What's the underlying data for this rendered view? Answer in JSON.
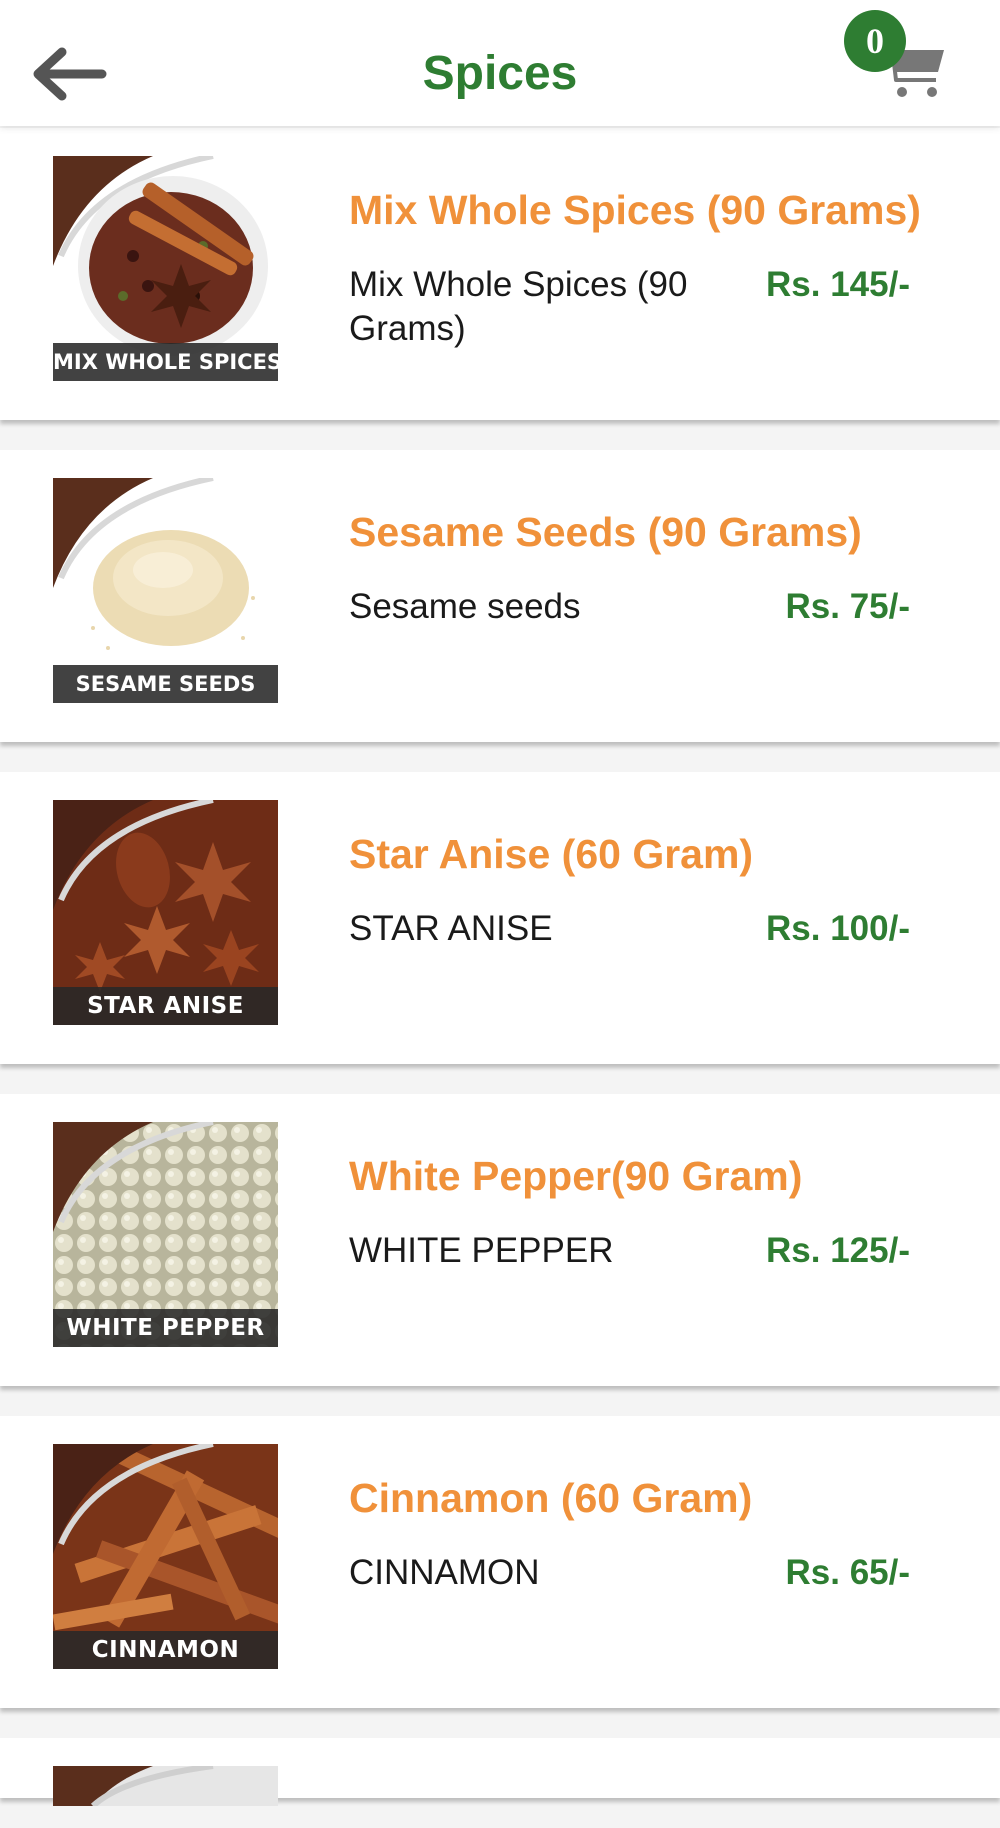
{
  "header": {
    "title": "Spices",
    "cart_count": "0"
  },
  "products": [
    {
      "name": "Mix Whole Spices (90 Grams)",
      "description": "Mix Whole Spices (90 Grams)",
      "price": "Rs. 145/-",
      "image_label": "MIX WHOLE SPICES"
    },
    {
      "name": "Sesame Seeds (90 Grams)",
      "description": "Sesame seeds",
      "price": "Rs. 75/-",
      "image_label": "SESAME SEEDS"
    },
    {
      "name": "Star Anise (60 Gram)",
      "description": "STAR ANISE",
      "price": "Rs. 100/-",
      "image_label": "STAR ANISE"
    },
    {
      "name": "White Pepper(90 Gram)",
      "description": "WHITE PEPPER",
      "price": "Rs. 125/-",
      "image_label": "WHITE PEPPER"
    },
    {
      "name": "Cinnamon (60 Gram)",
      "description": "CINNAMON",
      "price": "Rs. 65/-",
      "image_label": "CINNAMON"
    }
  ],
  "icons": {
    "back": "back-arrow-icon",
    "cart": "shopping-cart-icon"
  },
  "colors": {
    "brand_green": "#2e7d32",
    "product_orange": "#f0913a"
  }
}
